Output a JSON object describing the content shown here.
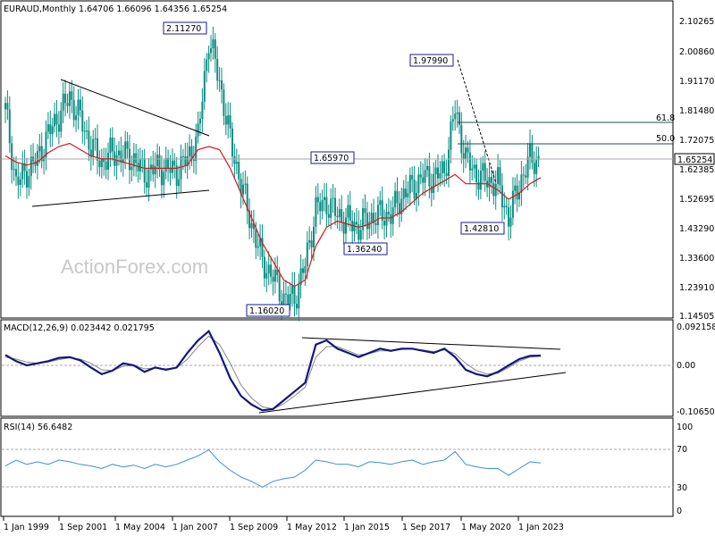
{
  "main_panel": {
    "header": "EURAUD,Monthly  1.64706 1.66096 1.64356 1.65254",
    "watermark": "ActionForex.com",
    "current_price_label": "1.65254",
    "price_axis": [
      "2.10265",
      "2.00860",
      "1.91170",
      "1.81480",
      "1.72075",
      "1.62385",
      "1.52695",
      "1.43290",
      "1.33600",
      "1.23910",
      "1.14505"
    ],
    "callouts": [
      "2.11270",
      "1.97990",
      "1.65970",
      "1.36240",
      "1.42810",
      "1.16020"
    ],
    "fib_labels": [
      "61.8",
      "50.0"
    ]
  },
  "macd_panel": {
    "header": "MACD(12,26,9) 0.023442 0.021795",
    "axis": [
      "0.092158",
      "0.00",
      "-0.106503"
    ]
  },
  "rsi_panel": {
    "header": "RSI(14) 56.6482",
    "axis": [
      "100",
      "70",
      "30",
      "0"
    ]
  },
  "date_axis": [
    "1 Jan 1999",
    "1 Sep 2001",
    "1 May 2004",
    "1 Jan 2007",
    "1 Sep 2009",
    "1 May 2012",
    "1 Jan 2015",
    "1 Sep 2017",
    "1 May 2020",
    "1 Jan 2023"
  ],
  "colors": {
    "candles": "#0b8d82",
    "moving_average": "#d81818",
    "macd_line": "#15157e",
    "macd_signal": "#888888",
    "rsi_line": "#3b8fd6",
    "callout_border": "#1a1a9e",
    "trendline": "#000000"
  },
  "chart_data": {
    "type": "line",
    "title": "EURAUD,Monthly",
    "x": [
      "1999-01",
      "1999-07",
      "2000-01",
      "2000-07",
      "2001-01",
      "2001-07",
      "2002-01",
      "2002-07",
      "2003-01",
      "2003-07",
      "2004-01",
      "2004-07",
      "2005-01",
      "2005-07",
      "2006-01",
      "2006-07",
      "2007-01",
      "2007-07",
      "2008-01",
      "2008-07",
      "2008-12",
      "2009-06",
      "2010-01",
      "2010-07",
      "2011-01",
      "2011-07",
      "2012-01",
      "2012-07",
      "2013-01",
      "2013-07",
      "2014-01",
      "2014-07",
      "2015-01",
      "2015-07",
      "2016-01",
      "2016-07",
      "2017-01",
      "2017-07",
      "2018-01",
      "2018-07",
      "2019-01",
      "2019-07",
      "2020-03",
      "2020-07",
      "2021-01",
      "2021-07",
      "2022-01",
      "2022-07",
      "2023-01",
      "2023-07",
      "2024-01"
    ],
    "series": [
      {
        "values": [
          1.82,
          1.58,
          1.62,
          1.66,
          1.74,
          1.8,
          1.86,
          1.79,
          1.7,
          1.65,
          1.68,
          1.67,
          1.66,
          1.61,
          1.63,
          1.63,
          1.62,
          1.66,
          1.73,
          2.05,
          1.91,
          1.72,
          1.58,
          1.45,
          1.33,
          1.28,
          1.21,
          1.21,
          1.32,
          1.5,
          1.52,
          1.48,
          1.46,
          1.44,
          1.47,
          1.48,
          1.48,
          1.54,
          1.57,
          1.6,
          1.6,
          1.62,
          1.82,
          1.66,
          1.61,
          1.59,
          1.58,
          1.47,
          1.58,
          1.66,
          1.65254
        ]
      },
      {
        "values": [
          1.67,
          1.65,
          1.64,
          1.65,
          1.68,
          1.7,
          1.71,
          1.69,
          1.67,
          1.66,
          1.66,
          1.65,
          1.64,
          1.63,
          1.63,
          1.63,
          1.63,
          1.64,
          1.69,
          1.7,
          1.69,
          1.63,
          1.55,
          1.47,
          1.39,
          1.33,
          1.27,
          1.25,
          1.27,
          1.38,
          1.44,
          1.46,
          1.45,
          1.44,
          1.45,
          1.47,
          1.47,
          1.49,
          1.52,
          1.55,
          1.57,
          1.59,
          1.61,
          1.58,
          1.58,
          1.58,
          1.56,
          1.53,
          1.55,
          1.58,
          1.6
        ]
      }
    ],
    "ylim": [
      1.14505,
      2.10265
    ],
    "reference_values": {
      "high_2008": 2.1127,
      "low_2012": 1.1602,
      "high_2020": 1.9799,
      "level_2015": 1.6597,
      "low_2015": 1.3624,
      "low_2022": 1.4281,
      "fib_618": 1.77,
      "fib_500": 1.7,
      "last": 1.65254
    },
    "macd": {
      "line": [
        0.025,
        0.01,
        0.0,
        0.005,
        0.01,
        0.018,
        0.02,
        0.012,
        -0.005,
        -0.02,
        -0.012,
        0.005,
        0.0,
        -0.015,
        -0.005,
        -0.01,
        -0.005,
        0.03,
        0.06,
        0.082,
        0.03,
        -0.03,
        -0.07,
        -0.09,
        -0.103,
        -0.1,
        -0.08,
        -0.06,
        -0.04,
        0.05,
        0.06,
        0.04,
        0.03,
        0.02,
        0.03,
        0.04,
        0.035,
        0.04,
        0.04,
        0.035,
        0.03,
        0.04,
        0.02,
        -0.01,
        -0.02,
        -0.025,
        -0.015,
        0.0,
        0.015,
        0.023,
        0.023442
      ],
      "signal": [
        0.02,
        0.015,
        0.008,
        0.005,
        0.008,
        0.014,
        0.018,
        0.015,
        0.005,
        -0.01,
        -0.012,
        -0.002,
        0.0,
        -0.008,
        -0.006,
        -0.008,
        -0.006,
        0.015,
        0.045,
        0.07,
        0.05,
        0.005,
        -0.045,
        -0.075,
        -0.095,
        -0.1,
        -0.088,
        -0.07,
        -0.05,
        0.02,
        0.045,
        0.045,
        0.035,
        0.025,
        0.028,
        0.035,
        0.035,
        0.038,
        0.039,
        0.037,
        0.033,
        0.037,
        0.028,
        0.005,
        -0.012,
        -0.02,
        -0.018,
        -0.005,
        0.01,
        0.02,
        0.021795
      ],
      "ylim": [
        -0.106503,
        0.092158
      ]
    },
    "rsi": {
      "values": [
        53,
        60,
        55,
        58,
        55,
        60,
        58,
        55,
        53,
        50,
        55,
        52,
        54,
        50,
        55,
        52,
        55,
        60,
        65,
        72,
        58,
        48,
        40,
        35,
        28,
        35,
        38,
        40,
        48,
        60,
        58,
        55,
        55,
        52,
        58,
        57,
        55,
        58,
        60,
        55,
        58,
        60,
        70,
        55,
        52,
        50,
        50,
        42,
        50,
        58,
        56.6482
      ],
      "ylim": [
        0,
        100
      ],
      "levels": [
        70,
        30
      ]
    }
  }
}
